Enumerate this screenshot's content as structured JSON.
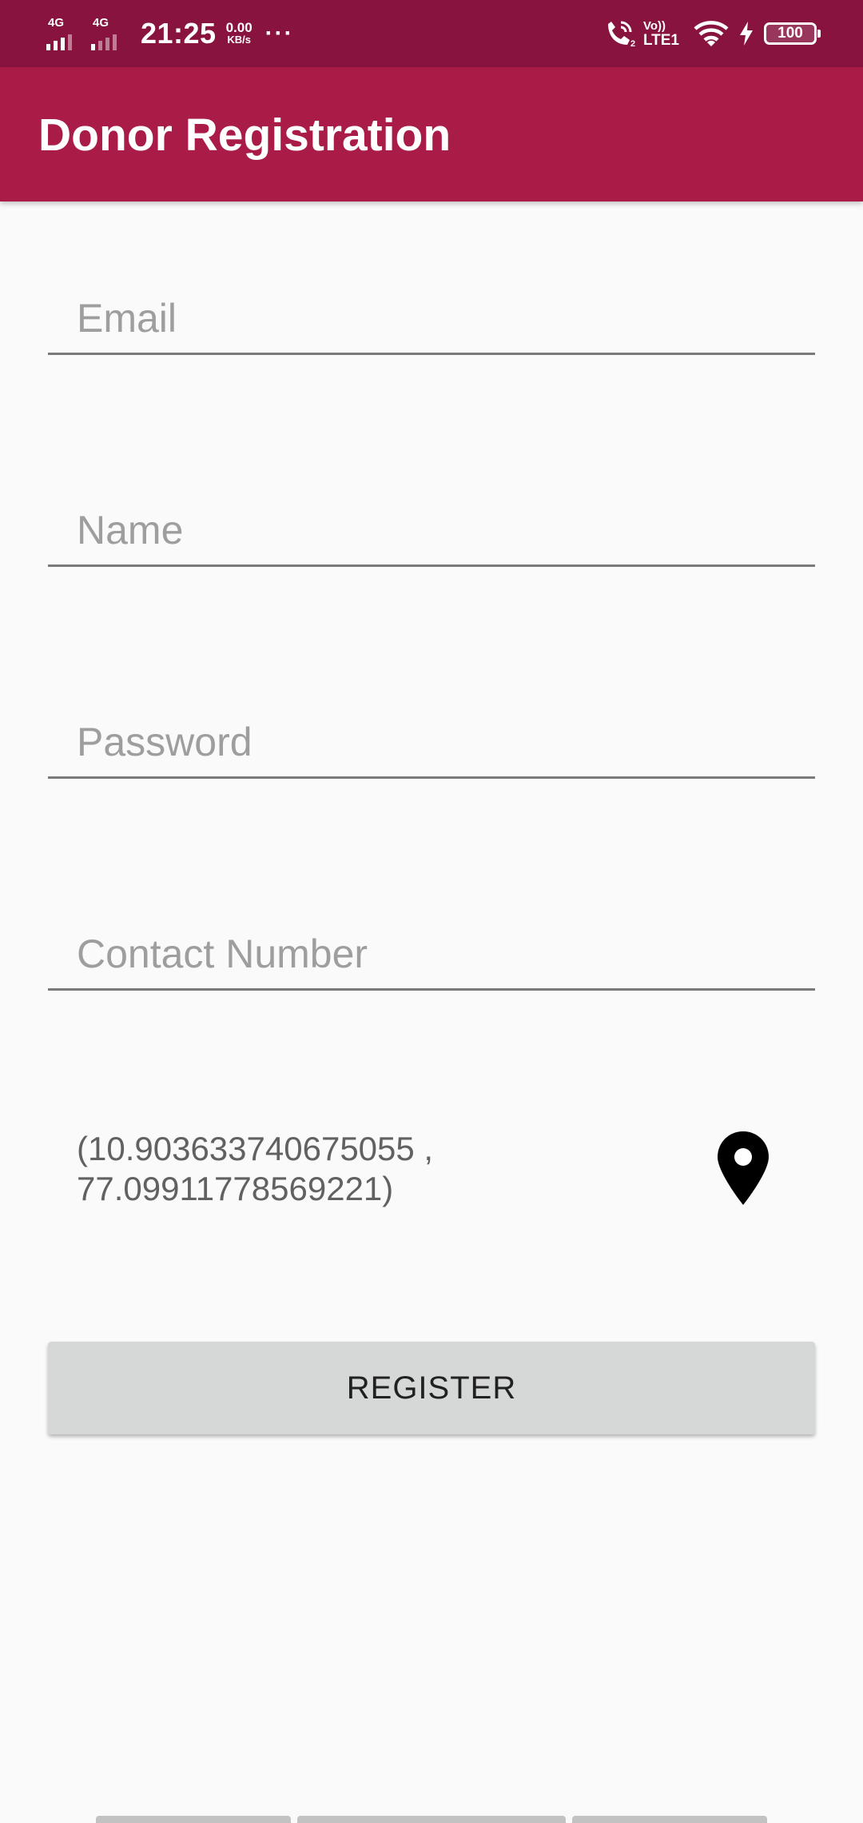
{
  "status_bar": {
    "sim1_network": "4G",
    "sim2_network": "4G",
    "time": "21:25",
    "speed_value": "0.00",
    "speed_unit": "KB/s",
    "more": "···",
    "call_sim_index": "2",
    "volte_top": "Vo))",
    "volte_bottom": "LTE1",
    "battery_level": "100"
  },
  "app_bar": {
    "title": "Donor Registration"
  },
  "form": {
    "email": {
      "placeholder": "Email",
      "value": ""
    },
    "name": {
      "placeholder": "Name",
      "value": ""
    },
    "password": {
      "placeholder": "Password",
      "value": ""
    },
    "contact": {
      "placeholder": "Contact Number",
      "value": ""
    },
    "location_line1": "(10.903633740675055 ,",
    "location_line2": "77.09911778569221)",
    "register_label": "REGISTER"
  },
  "icons": {
    "location": "map-pin-icon",
    "wifi": "wifi-icon",
    "charging": "bolt-icon",
    "call": "wifi-call-icon"
  },
  "colors": {
    "status_bar": "#88133f",
    "app_bar": "#a91c48",
    "background": "#fafafa",
    "button": "#d6d7d7",
    "underline": "#7a7a7a",
    "placeholder": "#9e9e9e"
  }
}
